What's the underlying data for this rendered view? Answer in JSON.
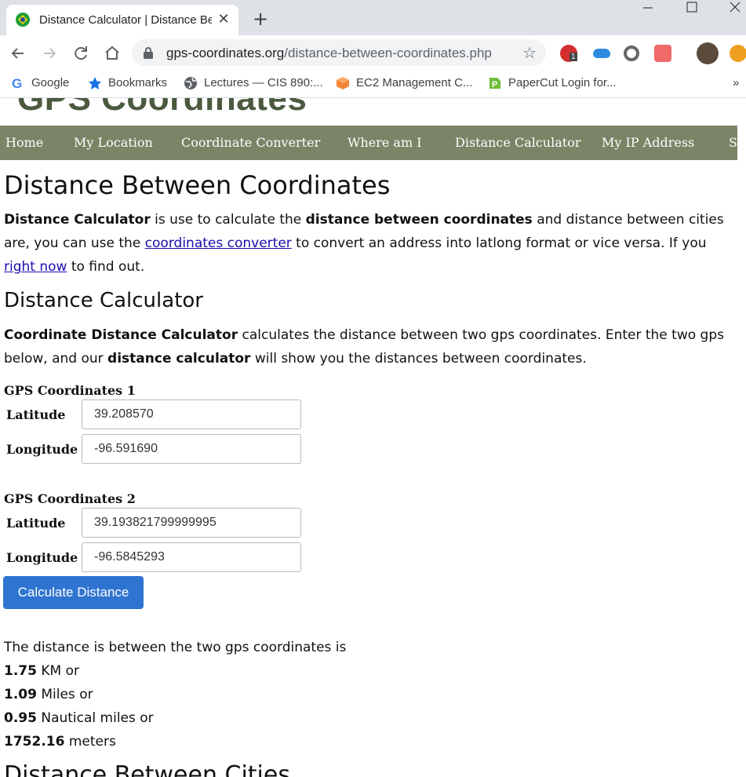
{
  "browser": {
    "tab_title": "Distance Calculator | Distance Bet",
    "close_glyph": "✕",
    "newtab_glyph": "+",
    "url_host": "gps-coordinates.org",
    "url_path": "/distance-between-coordinates.php",
    "extension_badge": "1",
    "bookmarks": [
      {
        "label": "Google"
      },
      {
        "label": "Bookmarks"
      },
      {
        "label": "Lectures — CIS 890:..."
      },
      {
        "label": "EC2 Management C..."
      },
      {
        "label": "PaperCut Login for..."
      }
    ],
    "bookmarks_more": "»"
  },
  "site": {
    "title": "GPS Coordinates",
    "nav": [
      "Home",
      "My Location",
      "Coordinate Converter",
      "Where am I",
      "Distance Calculator",
      "My IP Address",
      "S"
    ]
  },
  "content": {
    "h1": "Distance Between Coordinates",
    "intro": {
      "l1_b1": "Distance Calculator",
      "l1_t1": " is use to calculate the ",
      "l1_b2": "distance between coordinates",
      "l1_t2": " and distance between cities",
      "l2_t1": "are, you can use the ",
      "l2_link": "coordinates converter",
      "l2_t2": " to convert an address into latlong format or vice versa. If you",
      "l3_link": "right now",
      "l3_t1": " to find out."
    },
    "h2_calc": "Distance Calculator",
    "desc": {
      "l1_b1": "Coordinate Distance Calculator",
      "l1_t1": " calculates the distance between two gps coordinates. Enter the two gps",
      "l2_t1": "below, and our ",
      "l2_b1": "distance calculator",
      "l2_t2": " will show you the distances between coordinates."
    },
    "group1": {
      "label": "GPS Coordinates 1",
      "lat_label": "Latitude",
      "lat_value": "39.208570",
      "lon_label": "Longitude",
      "lon_value": "-96.591690"
    },
    "group2": {
      "label": "GPS Coordinates 2",
      "lat_label": "Latitude",
      "lat_value": "39.193821799999995",
      "lon_label": "Longitude",
      "lon_value": "-96.5845293"
    },
    "button": "Calculate Distance",
    "result": {
      "intro": "The distance is between the two gps coordinates is",
      "km": "1.75",
      "km_unit": " KM or",
      "miles": "1.09",
      "miles_unit": " Miles or",
      "nm": "0.95",
      "nm_unit": " Nautical miles or",
      "meters": "1752.16",
      "meters_unit": " meters"
    },
    "h2_cities": "Distance Between Cities"
  }
}
